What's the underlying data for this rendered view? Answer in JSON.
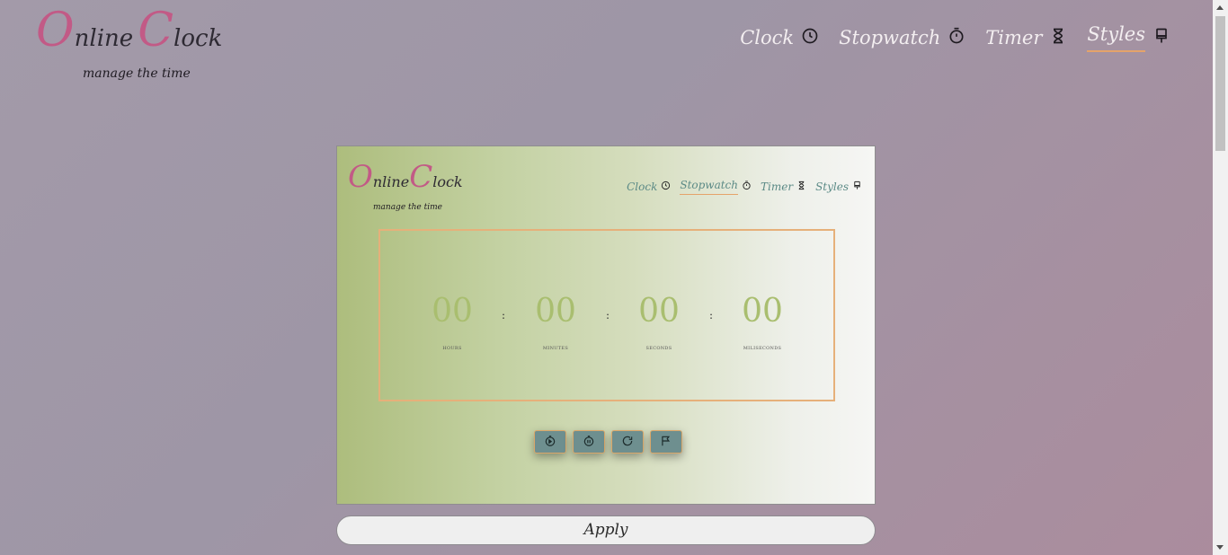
{
  "header": {
    "logo": {
      "o": "O",
      "nline": "nline",
      "c": "C",
      "lock": "lock"
    },
    "tagline": "manage the time",
    "nav": [
      {
        "label": "Clock",
        "icon": "clock-icon"
      },
      {
        "label": "Stopwatch",
        "icon": "stopwatch-icon"
      },
      {
        "label": "Timer",
        "icon": "hourglass-icon"
      },
      {
        "label": "Styles",
        "icon": "paint-brush-icon",
        "active": true
      }
    ]
  },
  "preview": {
    "logo": {
      "o": "O",
      "nline": "nline",
      "c": "C",
      "lock": "lock"
    },
    "tagline": "manage the time",
    "nav": [
      {
        "label": "Clock",
        "icon": "clock-icon"
      },
      {
        "label": "Stopwatch",
        "icon": "stopwatch-icon",
        "active": true
      },
      {
        "label": "Timer",
        "icon": "hourglass-icon"
      },
      {
        "label": "Styles",
        "icon": "paint-brush-icon"
      }
    ],
    "display": {
      "hours": "00",
      "minutes": "00",
      "seconds": "00",
      "milliseconds": "00",
      "separator": ":",
      "labels": {
        "hours": "HOURS",
        "minutes": "MINUTES",
        "seconds": "SECONDS",
        "milliseconds": "MILISECONDS"
      }
    },
    "controls": [
      "start-icon",
      "pause-icon",
      "reset-icon",
      "lap-flag-icon"
    ]
  },
  "apply_label": "Apply",
  "colors": {
    "accent": "#e5a36a",
    "logo_pink": "#c25a86",
    "digits": "#a9be6f",
    "control_bg": "#6e8f8f"
  }
}
